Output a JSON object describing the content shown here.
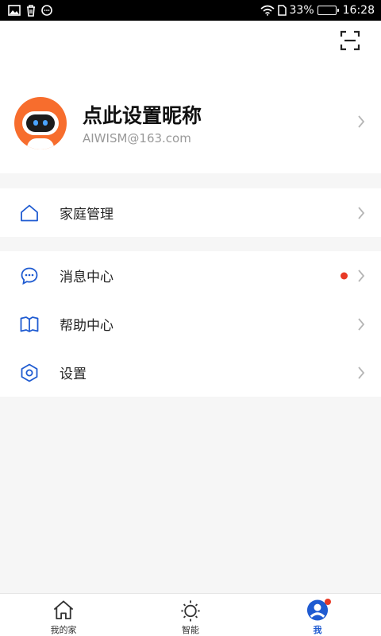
{
  "status": {
    "battery": "33%",
    "time": "16:28",
    "battery_level": 0.55,
    "icons_left": [
      "image-icon",
      "trash-icon",
      "chat-icon"
    ],
    "icons_right": [
      "wifi-icon",
      "sim-icon",
      "battery-icon"
    ]
  },
  "profile": {
    "nickname": "点此设置昵称",
    "email": "AIWISM@163.com"
  },
  "menu_group_1": [
    {
      "label": "家庭管理",
      "icon": "home-icon"
    }
  ],
  "menu_group_2": [
    {
      "label": "消息中心",
      "icon": "message-icon",
      "has_dot": true
    },
    {
      "label": "帮助中心",
      "icon": "book-icon"
    },
    {
      "label": "设置",
      "icon": "settings-icon"
    }
  ],
  "tabs": [
    {
      "label": "我的家",
      "icon": "home-icon"
    },
    {
      "label": "智能",
      "icon": "sun-icon"
    },
    {
      "label": "我",
      "icon": "user-icon",
      "active": true,
      "has_dot": true
    }
  ],
  "colors": {
    "accent": "#1f5bd1",
    "dot": "#e83a26",
    "avatar": "#f76d2d"
  }
}
